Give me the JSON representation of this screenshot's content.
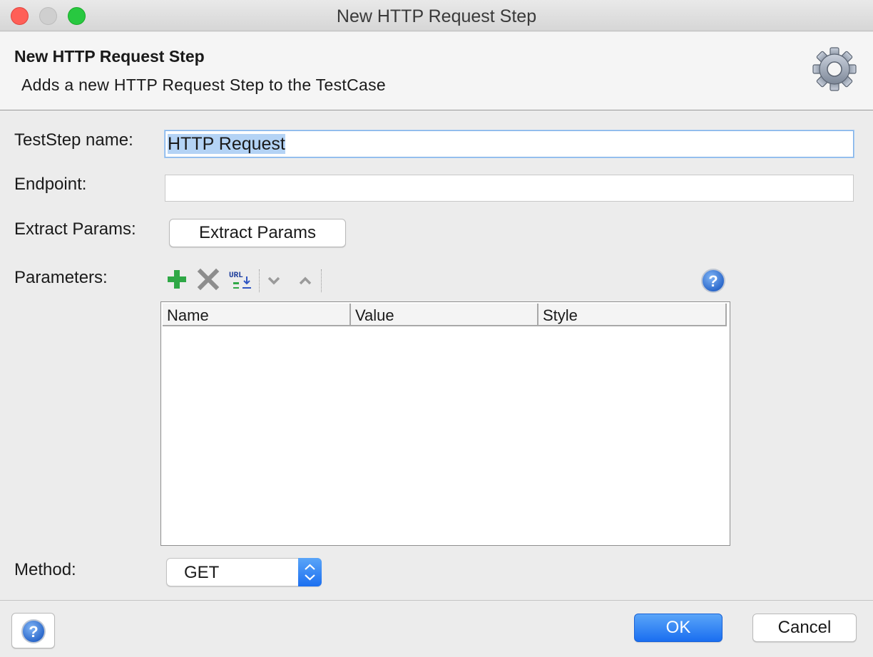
{
  "window": {
    "title": "New HTTP Request Step"
  },
  "header": {
    "title": "New HTTP Request Step",
    "description": "Adds a new HTTP Request Step to the TestCase"
  },
  "form": {
    "name_label": "TestStep name:",
    "name_value": "HTTP Request",
    "endpoint_label": "Endpoint:",
    "endpoint_value": "",
    "extract_label": "Extract Params:",
    "extract_button": "Extract Params",
    "parameters_label": "Parameters:",
    "method_label": "Method:",
    "method_value": "GET"
  },
  "toolbar": {
    "url_icon_text": "URL"
  },
  "table": {
    "columns": [
      "Name",
      "Value",
      "Style"
    ],
    "rows": []
  },
  "footer": {
    "ok_label": "OK",
    "cancel_label": "Cancel"
  },
  "colors": {
    "accent": "#1d73f0",
    "selection": "#b4d3f5"
  }
}
